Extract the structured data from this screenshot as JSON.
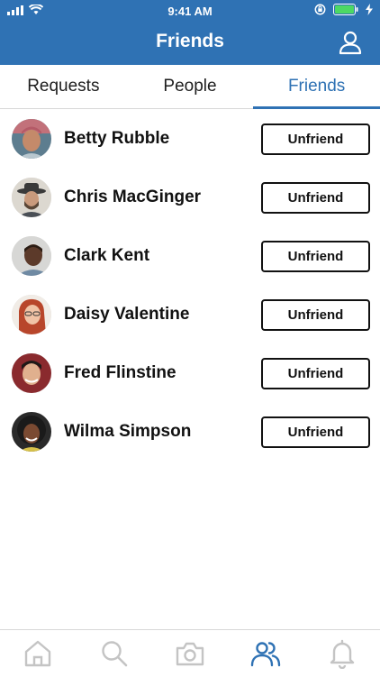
{
  "status_bar": {
    "time": "9:41 AM",
    "icons": [
      "signal-icon",
      "wifi-icon",
      "orientation-lock-icon",
      "battery-icon",
      "charging-icon"
    ]
  },
  "header": {
    "title": "Friends",
    "profile_icon": "profile-icon"
  },
  "tabs": [
    {
      "label": "Requests",
      "active": false
    },
    {
      "label": "People",
      "active": false
    },
    {
      "label": "Friends",
      "active": true
    }
  ],
  "friends": [
    {
      "name": "Betty Rubble",
      "action": "Unfriend"
    },
    {
      "name": "Chris MacGinger",
      "action": "Unfriend"
    },
    {
      "name": "Clark Kent",
      "action": "Unfriend"
    },
    {
      "name": "Daisy Valentine",
      "action": "Unfriend"
    },
    {
      "name": "Fred Flinstine",
      "action": "Unfriend"
    },
    {
      "name": "Wilma Simpson",
      "action": "Unfriend"
    }
  ],
  "bottom_nav": [
    {
      "icon": "home-icon",
      "active": false
    },
    {
      "icon": "search-icon",
      "active": false
    },
    {
      "icon": "camera-icon",
      "active": false
    },
    {
      "icon": "friends-icon",
      "active": true
    },
    {
      "icon": "bell-icon",
      "active": false
    }
  ],
  "colors": {
    "accent": "#2f72b4",
    "battery": "#4cd964",
    "inactive_icon": "#c4c4c4"
  }
}
